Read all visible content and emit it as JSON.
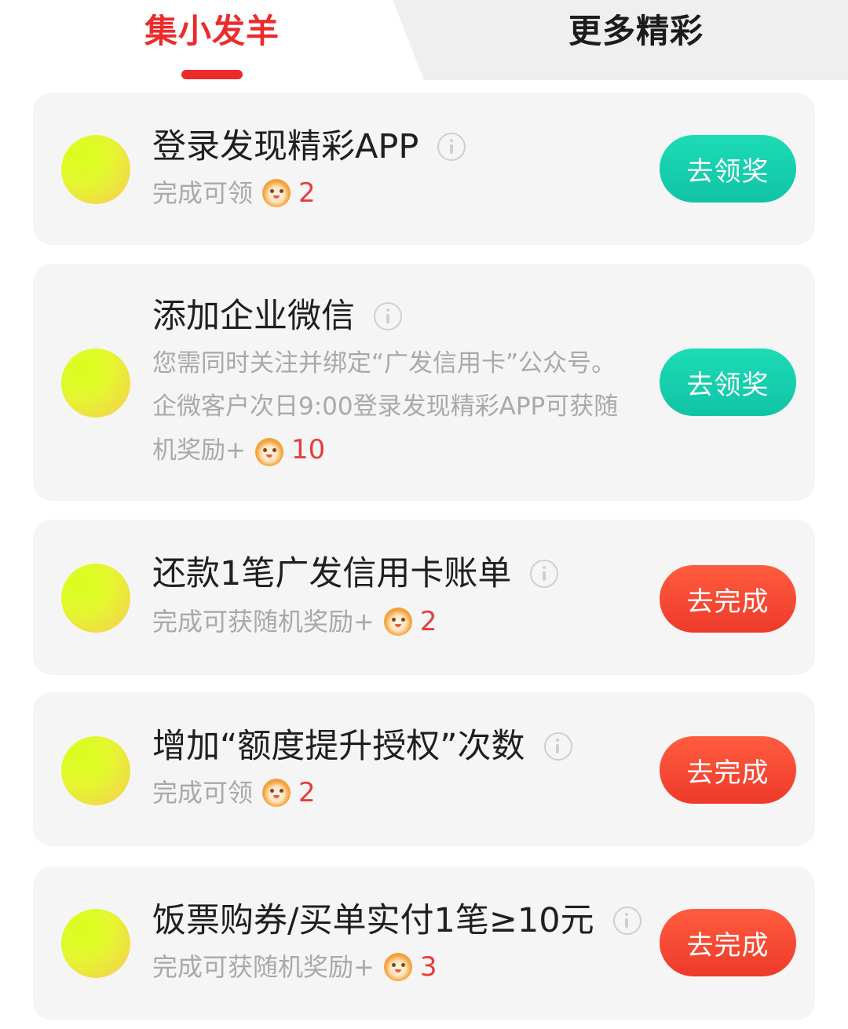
{
  "tabs": {
    "active_label": "集小发羊",
    "other_label": "更多精彩"
  },
  "tasks": [
    {
      "title": "登录发现精彩APP",
      "reward_text": "完成可领",
      "reward_amount": "2",
      "button_label": "去领奖",
      "button_color": "#14cfac"
    },
    {
      "title": "添加企业微信",
      "desc_before": "您需同时关注并绑定“广发信用卡”公众号。企微客户次日9:00登录发现精彩APP可获随机奖励+",
      "reward_amount": "10",
      "button_label": "去领奖",
      "button_color": "#14cfac"
    },
    {
      "title": "还款1笔广发信用卡账单",
      "reward_text": "完成可获随机奖励+",
      "reward_amount": "2",
      "button_label": "去完成",
      "button_color": "#f2432f"
    },
    {
      "title": "增加“额度提升授权”次数",
      "reward_text": "完成可领",
      "reward_amount": "2",
      "button_label": "去完成",
      "button_color": "#f2432f"
    },
    {
      "title": "饭票购券/买单实付1笔≥10元",
      "reward_text": "完成可获随机奖励+",
      "reward_amount": "3",
      "button_label": "去完成",
      "button_color": "#f2432f"
    }
  ],
  "colors": {
    "accent": "#ec2b2b",
    "amount": "#e63c3c",
    "card_bg": "#f5f5f5",
    "muted_text": "#a9a9a9"
  }
}
